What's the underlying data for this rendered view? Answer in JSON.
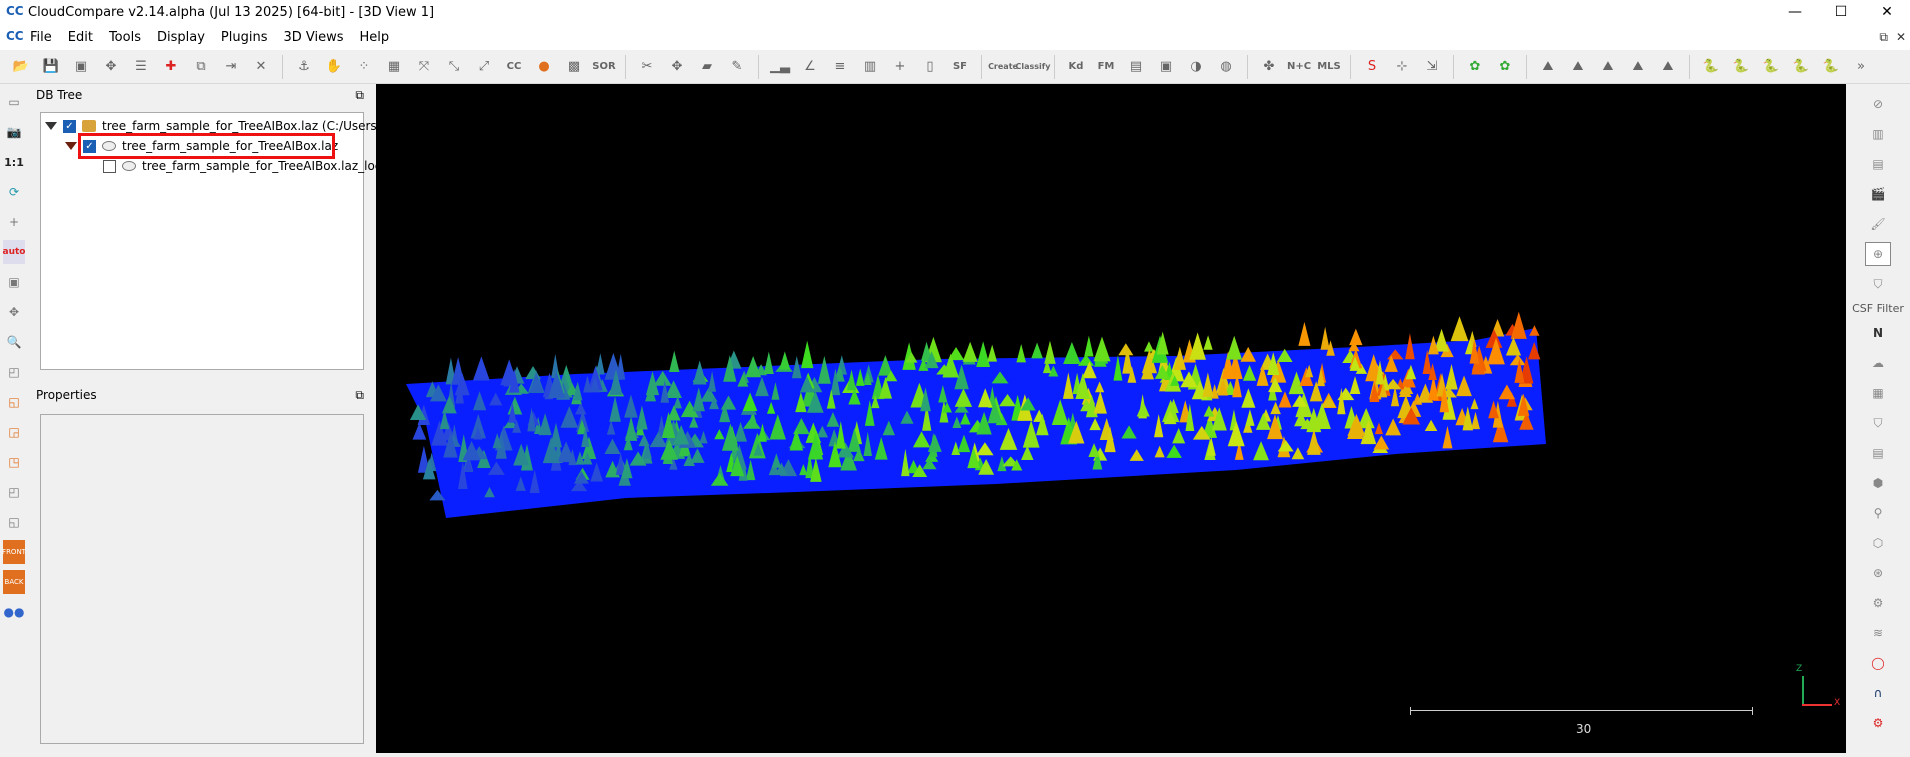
{
  "window": {
    "title": "CloudCompare v2.14.alpha (Jul 13 2025) [64-bit] - [3D View 1]",
    "controls": [
      "—",
      "☐",
      "✕"
    ]
  },
  "menu": {
    "items": [
      "File",
      "Edit",
      "Tools",
      "Display",
      "Plugins",
      "3D Views",
      "Help"
    ]
  },
  "toolbar": {
    "text_buttons": {
      "sor": "SOR",
      "sf": "SF",
      "create": "Create",
      "classify": "Classify",
      "kd": "Kd",
      "fm": "FM",
      "nc": "N+C",
      "mls": "MLS"
    }
  },
  "db_tree": {
    "title": "DB Tree",
    "items": [
      {
        "label": "tree_farm_sample_for_TreeAIBox.laz (C:/Users/...",
        "checked": true
      },
      {
        "label": "tree_farm_sample_for_TreeAIBox.laz",
        "checked": true
      },
      {
        "label": "tree_farm_sample_for_TreeAIBox.laz_loc",
        "checked": false
      }
    ]
  },
  "properties": {
    "title": "Properties"
  },
  "left_toolbar": {
    "ratio_label": "1:1",
    "auto_label": "auto",
    "front_label": "FRONT",
    "back_label": "BACK"
  },
  "right_toolbar": {
    "csf_label": "CSF Filter",
    "n_label": "N"
  },
  "view": {
    "scale_label": "30",
    "axis_z": "Z",
    "axis_x": "X"
  },
  "colors": {
    "background": "#000000",
    "ground": "#0a1fff",
    "highlight": "#ee1111"
  }
}
